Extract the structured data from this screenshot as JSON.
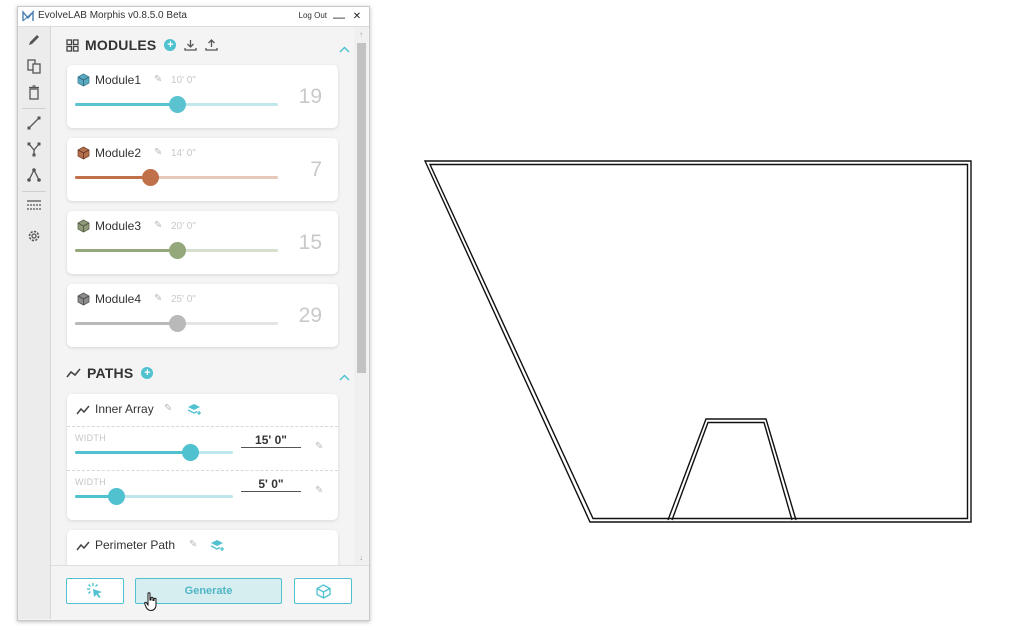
{
  "window": {
    "title": "EvolveLAB Morphis v0.8.5.0 Beta",
    "logout_label": "Log Out",
    "minimize_glyph": "—",
    "close_glyph": "✕"
  },
  "sidebar": {
    "icons": [
      "pencil-icon",
      "documents-icon",
      "trash-icon",
      "line-tool-icon",
      "branch-tool-icon",
      "node-tool-icon",
      "layers-icon",
      "gear-icon"
    ]
  },
  "modules_section": {
    "title": "MODULES",
    "modules": [
      {
        "name": "Module1",
        "dimension": "10' 0\"",
        "count": "19",
        "color": "#5bc3d0",
        "slider": 0.5
      },
      {
        "name": "Module2",
        "dimension": "14' 0\"",
        "count": "7",
        "color": "#c0714a",
        "slider": 0.37
      },
      {
        "name": "Module3",
        "dimension": "20' 0\"",
        "count": "15",
        "color": "#94a87b",
        "slider": 0.5
      },
      {
        "name": "Module4",
        "dimension": "25' 0\"",
        "count": "29",
        "color": "#b9b9b9",
        "slider": 0.5
      }
    ]
  },
  "paths_section": {
    "title": "PATHS",
    "paths": [
      {
        "name": "Inner Array",
        "fields": [
          {
            "label": "WIDTH",
            "value": "15'  0\"",
            "slider": 0.73
          },
          {
            "label": "WIDTH",
            "value": "5'  0\"",
            "slider": 0.26
          }
        ]
      },
      {
        "name": "Perimeter Path"
      }
    ]
  },
  "bottom": {
    "generate_label": "Generate"
  },
  "colors": {
    "accent": "#4fc1cf"
  }
}
